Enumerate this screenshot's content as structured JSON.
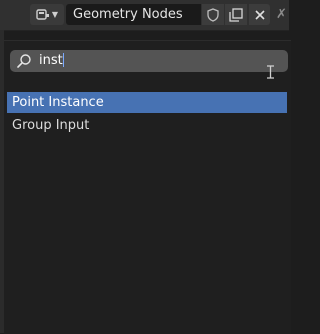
{
  "header": {
    "editor_type_icon": "node-editor-icon",
    "node_tree_name": "Geometry Nodes",
    "buttons": {
      "fake_user_icon": "shield-icon",
      "duplicate_icon": "duplicate-icon",
      "unlink_icon": "close-icon"
    }
  },
  "search": {
    "value": "inst",
    "icon": "search-icon"
  },
  "results": [
    {
      "label": "Point Instance",
      "active": true
    },
    {
      "label": "Group Input",
      "active": false
    }
  ],
  "colors": {
    "highlight": "#4772b3",
    "background": "#1d1d1d",
    "search_field": "#545454"
  }
}
